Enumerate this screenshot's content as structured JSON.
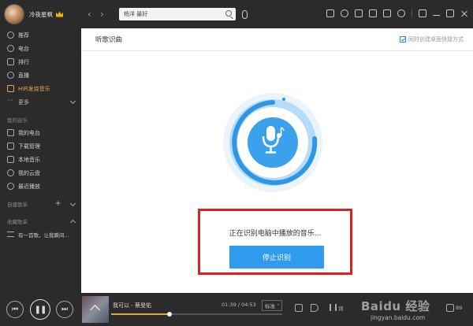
{
  "user": {
    "name": "冷夜星枫"
  },
  "sidebar": {
    "nav": [
      {
        "label": "推荐",
        "icon": "recommend-icon"
      },
      {
        "label": "电台",
        "icon": "radio-icon"
      },
      {
        "label": "排行",
        "icon": "chart-icon"
      },
      {
        "label": "直播",
        "icon": "live-mic-icon"
      },
      {
        "label": "HiFi发烧音乐",
        "icon": "hifi-icon"
      },
      {
        "label": "更多",
        "icon": "more-dots-icon"
      }
    ],
    "my_music_title": "我的音乐",
    "my_music": [
      {
        "label": "我的电台",
        "icon": "my-radio-icon"
      },
      {
        "label": "下载管理",
        "icon": "download-icon"
      },
      {
        "label": "本地音乐",
        "icon": "local-music-icon"
      },
      {
        "label": "我的云盘",
        "icon": "cloud-icon"
      },
      {
        "label": "最近播放",
        "icon": "history-icon"
      }
    ],
    "created_title": "自建歌单",
    "collected_title": "收藏歌单",
    "collected": [
      {
        "label": "有一首歌，让我瞬间..."
      }
    ]
  },
  "topbar": {
    "search_value": "杨洋 最好",
    "icons": [
      "playlist-icon",
      "headphones-icon",
      "gamepad-icon",
      "skin-icon",
      "message-icon",
      "settings-icon",
      "mini-mode-icon",
      "minimize-icon",
      "maximize-icon",
      "close-icon"
    ]
  },
  "page": {
    "title": "听歌识曲",
    "desktop_shortcut_label": "同时创建桌面快捷方式",
    "desktop_shortcut_checked": true,
    "status_text": "正在识别电脑中播放的音乐...",
    "stop_button": "停止识别"
  },
  "player": {
    "song": "我可以 - 蔡旻佑",
    "elapsed": "01:39",
    "total": "04:53",
    "progress": 0.34,
    "quality": "标准",
    "lyrics_label": "词",
    "playlist_count": "89"
  },
  "watermark": {
    "brand": "Baidu 经验",
    "url": "jingyan.baidu.com"
  },
  "colors": {
    "accent": "#2e9bef",
    "highlight_border": "#e02020",
    "hifi": "#f0a050",
    "dark_bg": "#2b2b2b"
  }
}
